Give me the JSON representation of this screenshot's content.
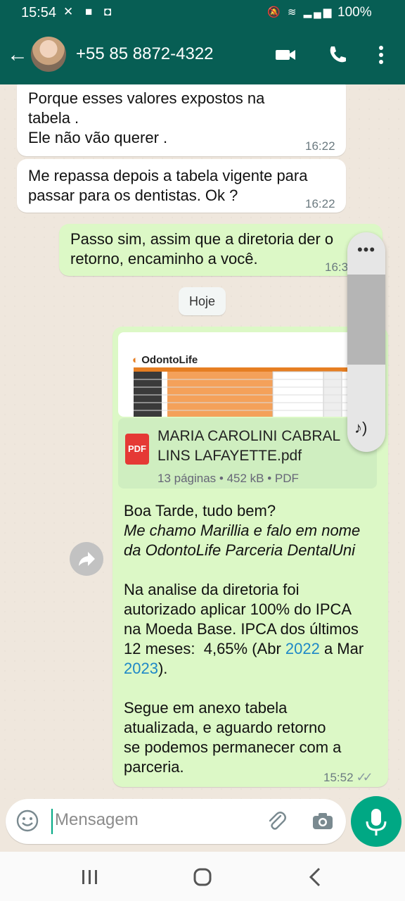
{
  "status_bar": {
    "time": "15:54",
    "battery": "100%"
  },
  "header": {
    "contact": "+55 85 8872-4322"
  },
  "messages": {
    "m1": {
      "lines": [
        "Porque esses valores expostos na",
        "tabela .",
        "Ele não vão querer ."
      ],
      "time": "16:22"
    },
    "m2": {
      "lines": [
        "Me repassa depois a tabela vigente para",
        "passar para os dentistas. Ok ?"
      ],
      "time": "16:22"
    },
    "m3": {
      "lines": [
        "Passo sim, assim que a diretoria der o",
        "retorno, encaminho a você."
      ],
      "time": "16:3"
    },
    "date_chip": "Hoje",
    "doc": {
      "brand": "OdontoLife",
      "file_name": "MARIA CAROLINI CABRAL LINS LAFAYETTE.pdf",
      "file_type_badge": "PDF",
      "meta": "13 páginas • 452 kB • PDF"
    },
    "m4": {
      "line1": "Boa Tarde, tudo bem?",
      "italic1": "Me chamo Marillia e falo em nome",
      "italic2": "da OdontoLife Parceria DentalUni",
      "p2_1": "Na analise da diretoria foi",
      "p2_2": "autorizado aplicar 100% do IPCA",
      "p2_3": "na Moeda Base. IPCA dos últimos",
      "p2_4a": "12 meses:  4,65% (Abr ",
      "p2_4b": "2022",
      "p2_4c": " a Mar",
      "p2_5a": "2023",
      "p2_5b": ").",
      "p3_1": "Segue em anexo tabela",
      "p3_2": "atualizada, e aguardo retorno",
      "p3_3": "se podemos permanecer com a",
      "p3_4": "parceria.",
      "time": "15:52"
    }
  },
  "input": {
    "placeholder": "Mensagem"
  },
  "colors": {
    "header": "#075e54",
    "out_bubble": "#dcf8c6",
    "accent": "#00a884",
    "link": "#1e88c7"
  }
}
